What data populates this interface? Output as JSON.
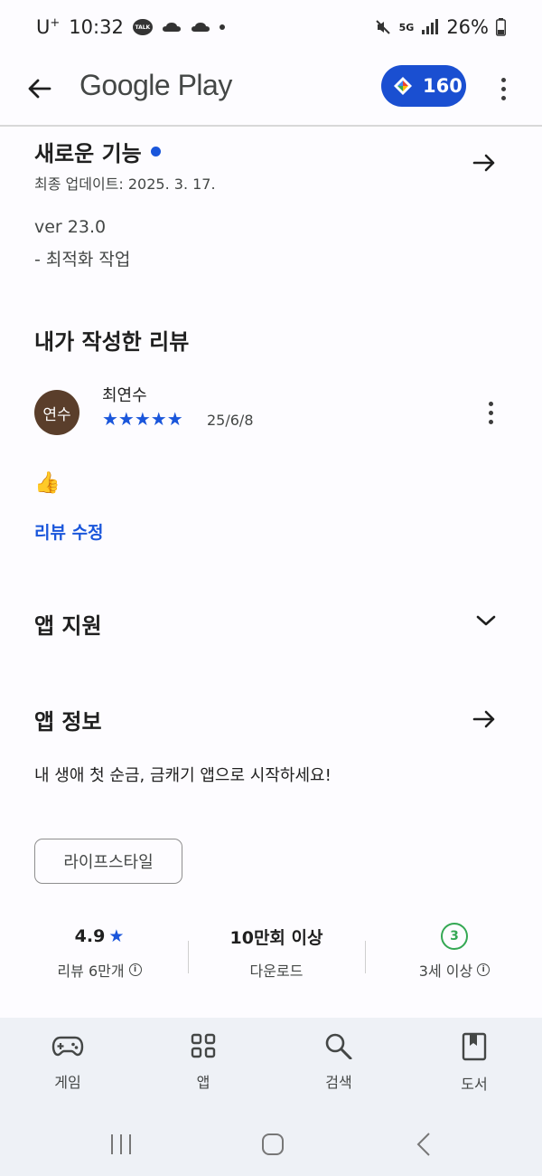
{
  "status_bar": {
    "carrier": "U",
    "carrier_sup": "+",
    "time": "10:32",
    "talk_badge": "TALK",
    "network": "5G",
    "battery": "26%"
  },
  "app_bar": {
    "title": "Google Play",
    "points": "160"
  },
  "whats_new": {
    "title": "새로운 기능",
    "updated": "최종 업데이트: 2025. 3. 17.",
    "version": "ver 23.0",
    "note": "- 최적화 작업"
  },
  "my_review": {
    "title": "내가 작성한 리뷰",
    "avatar_text": "연수",
    "reviewer": "최연수",
    "stars": "★★★★★",
    "rating": 5,
    "date": "25/6/8",
    "body": "👍",
    "edit_label": "리뷰 수정"
  },
  "app_support": {
    "title": "앱 지원"
  },
  "about": {
    "title": "앱 정보",
    "description": "내 생애 첫 순금, 금캐기 앱으로 시작하세요!",
    "category": "라이프스타일"
  },
  "stats": {
    "rating_value": "4.9",
    "rating_star": "★",
    "rating_label": "리뷰 6만개",
    "downloads_value": "10만회 이상",
    "downloads_label": "다운로드",
    "age_badge": "3",
    "age_label": "3세 이상"
  },
  "bottom_nav": {
    "items": [
      {
        "label": "게임",
        "icon": "gamepad-icon"
      },
      {
        "label": "앱",
        "icon": "apps-grid-icon"
      },
      {
        "label": "검색",
        "icon": "search-icon"
      },
      {
        "label": "도서",
        "icon": "book-icon"
      }
    ]
  },
  "colors": {
    "accent_blue": "#1a56db",
    "points_pill": "#1a4fd1",
    "age_green": "#34a853",
    "avatar_brown": "#5a3e2b",
    "nav_bg": "#eef1f6"
  }
}
